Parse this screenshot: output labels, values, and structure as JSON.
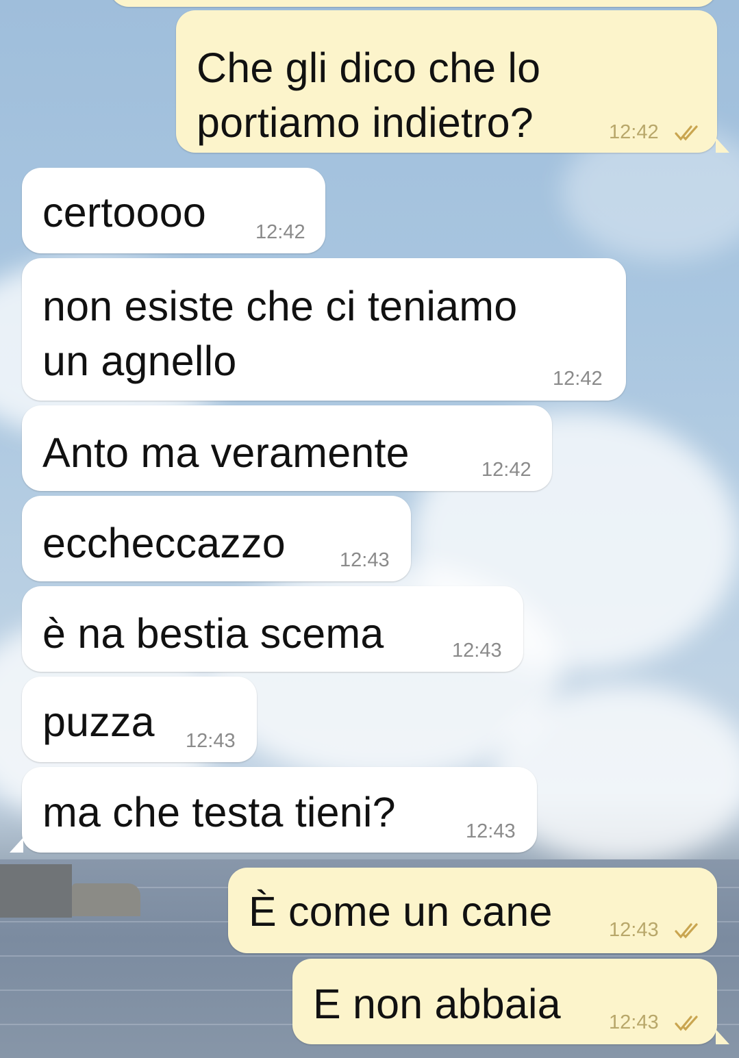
{
  "chat": {
    "messages": [
      {
        "direction": "out",
        "text": "Che gli dico che lo\nportiamo indietro?",
        "time": "12:42",
        "status": "read-ticks-icon"
      },
      {
        "direction": "in",
        "text": "certoooo",
        "time": "12:42"
      },
      {
        "direction": "in",
        "text": "non esiste che ci teniamo\nun agnello",
        "time": "12:42"
      },
      {
        "direction": "in",
        "text": "Anto ma veramente",
        "time": "12:42"
      },
      {
        "direction": "in",
        "text": "eccheccazzo",
        "time": "12:43"
      },
      {
        "direction": "in",
        "text": "è na bestia scema",
        "time": "12:43"
      },
      {
        "direction": "in",
        "text": "puzza",
        "time": "12:43"
      },
      {
        "direction": "in",
        "text": "ma che testa tieni?",
        "time": "12:43"
      },
      {
        "direction": "out",
        "text": "È come un cane",
        "time": "12:43",
        "status": "read-ticks-icon"
      },
      {
        "direction": "out",
        "text": "E non abbaia",
        "time": "12:43",
        "status": "read-ticks-icon"
      }
    ]
  },
  "colors": {
    "incoming_bubble": "#ffffff",
    "outgoing_bubble": "#fcf4cb",
    "tick_color": "#c9a550",
    "time_color": "#8a8a8a"
  }
}
